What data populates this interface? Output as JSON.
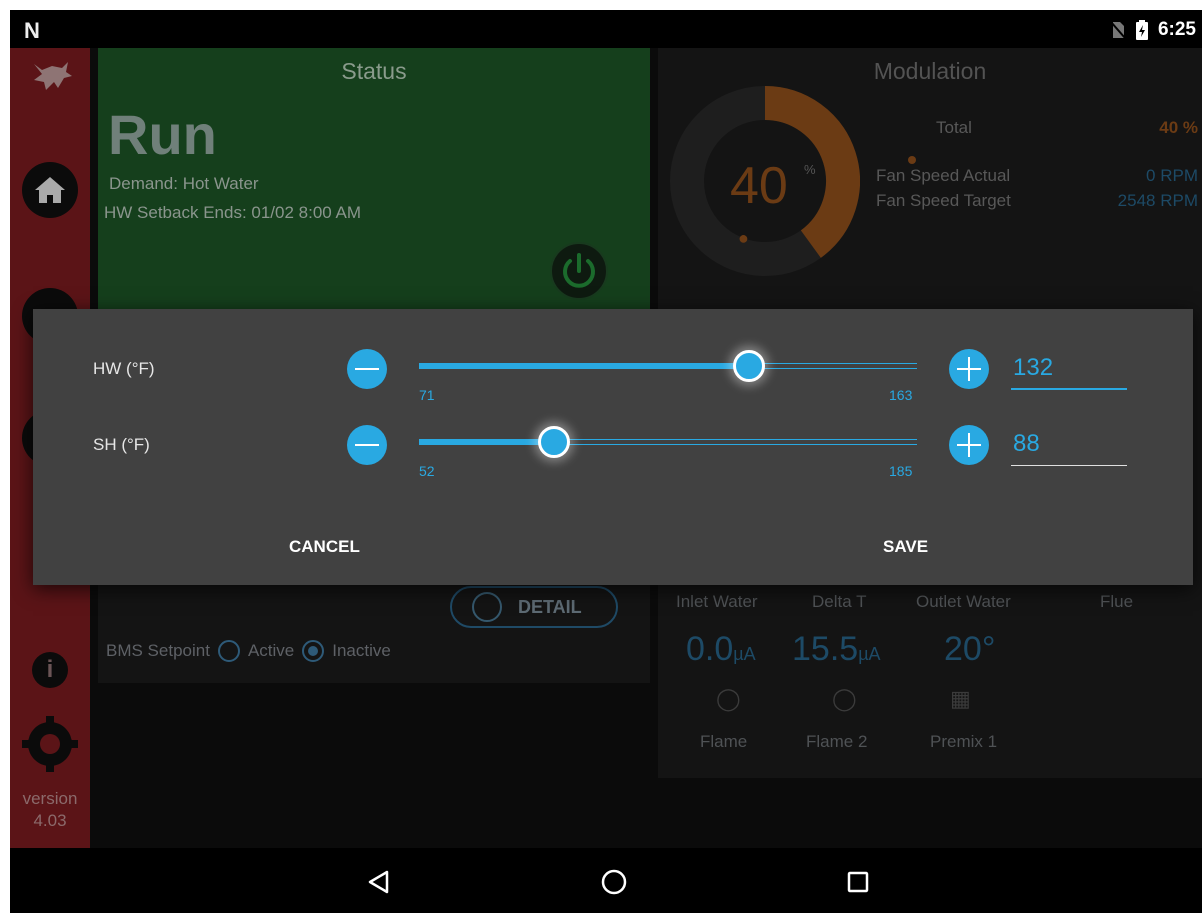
{
  "status_bar": {
    "time": "6:25"
  },
  "sidebar": {
    "version_label": "version",
    "version_number": "4.03"
  },
  "status_panel": {
    "title": "Status",
    "state": "Run",
    "demand": "Demand: Hot Water",
    "setback": "HW Setback Ends: 01/02 8:00 AM"
  },
  "modulation": {
    "title": "Modulation",
    "gauge_value": "40",
    "gauge_unit": "%",
    "gauge_fraction": 0.4,
    "rows": [
      {
        "label": "Total",
        "value": "40 %"
      },
      {
        "label": "Fan Speed Actual",
        "value": "0 RPM"
      },
      {
        "label": "Fan Speed Target",
        "value": "2548 RPM"
      }
    ]
  },
  "lower_left": {
    "detail_label": "DETAIL",
    "bms_label": "BMS Setpoint",
    "active_label": "Active",
    "inactive_label": "Inactive"
  },
  "lower_right": {
    "columns": [
      "Inlet Water",
      "Delta T",
      "Outlet Water",
      "Flue"
    ],
    "values": [
      "0.0",
      "15.5",
      "20°"
    ],
    "value_units": [
      "µA",
      "µA",
      ""
    ],
    "footers": [
      "Flame",
      "Flame 2",
      "Premix 1"
    ]
  },
  "dialog": {
    "hw": {
      "label": "HW (°F)",
      "min": "71",
      "max": "163",
      "value": "132",
      "fraction": 0.663
    },
    "sh": {
      "label": "SH (°F)",
      "min": "52",
      "max": "185",
      "value": "88",
      "fraction": 0.271
    },
    "cancel_label": "CANCEL",
    "save_label": "SAVE"
  },
  "colors": {
    "accent": "#29a9e2",
    "status_green": "#153f1c",
    "sidebar_red": "#5b1417",
    "gauge_orange": "#6b3b14"
  }
}
